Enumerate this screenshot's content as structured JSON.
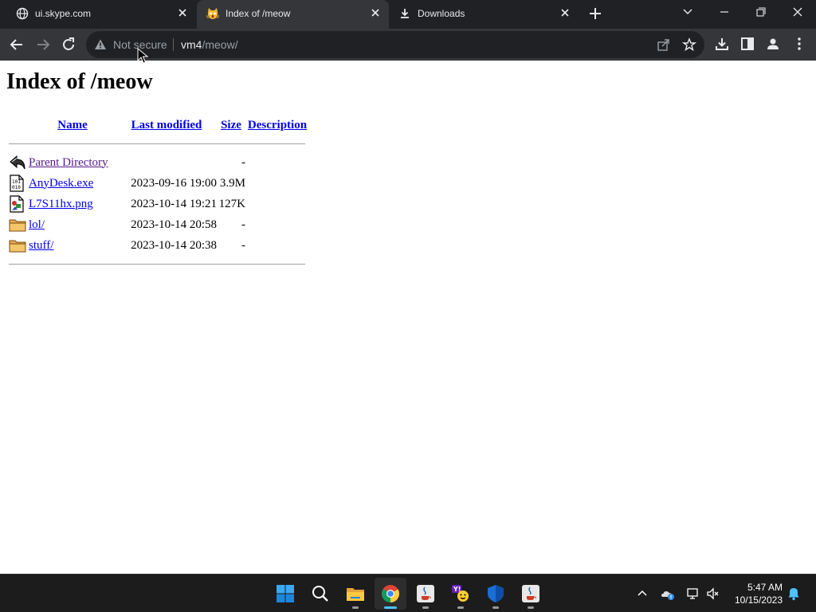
{
  "browser": {
    "tabs": [
      {
        "title": "ui.skype.com",
        "icon": "globe-icon",
        "active": false
      },
      {
        "title": "Index of /meow",
        "icon": "scream-cat-emoji-icon",
        "active": true
      },
      {
        "title": "Downloads",
        "icon": "download-arrow-icon",
        "active": false
      }
    ],
    "omnibox": {
      "security_label": "Not secure",
      "url_host": "vm4",
      "url_path": "/meow/"
    }
  },
  "page": {
    "title": "Index of /meow",
    "columns": {
      "name": "Name",
      "last_modified": "Last modified",
      "size": "Size",
      "description": "Description"
    },
    "rows": [
      {
        "name": "Parent Directory",
        "icon": "back-arrow-icon",
        "modified": "",
        "size": "-",
        "visited": true
      },
      {
        "name": "AnyDesk.exe",
        "icon": "binary-file-icon",
        "modified": "2023-09-16 19:00",
        "size": "3.9M",
        "visited": false
      },
      {
        "name": "L7S11hx.png",
        "icon": "image-file-icon",
        "modified": "2023-10-14 19:21",
        "size": "127K",
        "visited": false
      },
      {
        "name": "lol/",
        "icon": "folder-icon",
        "modified": "2023-10-14 20:58",
        "size": "-",
        "visited": false
      },
      {
        "name": "stuff/",
        "icon": "folder-icon",
        "modified": "2023-10-14 20:38",
        "size": "-",
        "visited": false
      }
    ]
  },
  "taskbar": {
    "apps": [
      "start-icon",
      "search-icon",
      "file-explorer-icon",
      "chrome-icon",
      "java-icon",
      "yahoo-messenger-icon",
      "defender-icon",
      "java-icon"
    ],
    "clock": {
      "time": "5:47 AM",
      "date": "10/15/2023"
    }
  },
  "colors": {
    "chrome_bg": "#202124",
    "toolbar_bg": "#35363a",
    "link": "#0000ee",
    "visited_link": "#551a8b",
    "taskbar_bg": "#1c1c1c",
    "taskbar_accent": "#4cc2ff"
  }
}
